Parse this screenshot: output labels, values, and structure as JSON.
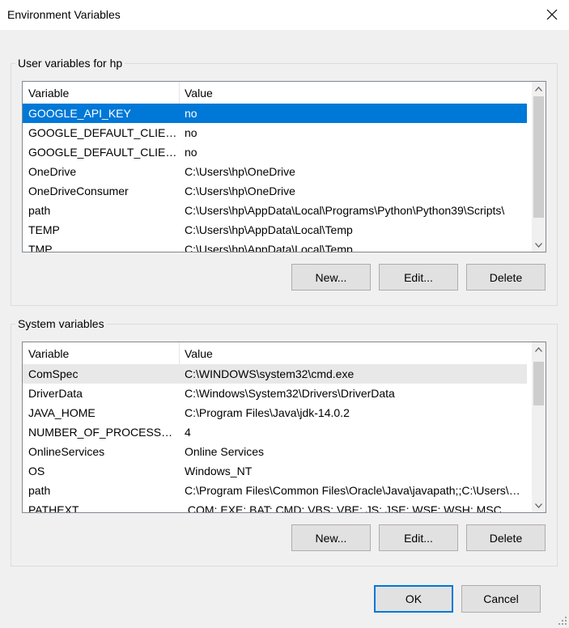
{
  "window": {
    "title": "Environment Variables",
    "close_icon": "close-icon"
  },
  "user_vars": {
    "group_label": "User variables for hp",
    "columns": [
      "Variable",
      "Value"
    ],
    "rows": [
      {
        "name": "GOOGLE_API_KEY",
        "value": "no"
      },
      {
        "name": "GOOGLE_DEFAULT_CLIENT_ID",
        "value": "no"
      },
      {
        "name": "GOOGLE_DEFAULT_CLIENT_SECRET",
        "value": "no"
      },
      {
        "name": "OneDrive",
        "value": "C:\\Users\\hp\\OneDrive"
      },
      {
        "name": "OneDriveConsumer",
        "value": "C:\\Users\\hp\\OneDrive"
      },
      {
        "name": "path",
        "value": "C:\\Users\\hp\\AppData\\Local\\Programs\\Python\\Python39\\Scripts\\"
      },
      {
        "name": "TEMP",
        "value": "C:\\Users\\hp\\AppData\\Local\\Temp"
      },
      {
        "name": "TMP",
        "value": "C:\\Users\\hp\\AppData\\Local\\Temp"
      }
    ],
    "selected_index": 0,
    "buttons": {
      "new": "New...",
      "edit": "Edit...",
      "delete": "Delete"
    }
  },
  "system_vars": {
    "group_label": "System variables",
    "columns": [
      "Variable",
      "Value"
    ],
    "rows": [
      {
        "name": "ComSpec",
        "value": "C:\\WINDOWS\\system32\\cmd.exe"
      },
      {
        "name": "DriverData",
        "value": "C:\\Windows\\System32\\Drivers\\DriverData"
      },
      {
        "name": "JAVA_HOME",
        "value": "C:\\Program Files\\Java\\jdk-14.0.2"
      },
      {
        "name": "NUMBER_OF_PROCESSORS",
        "value": "4"
      },
      {
        "name": "OnlineServices",
        "value": "Online Services"
      },
      {
        "name": "OS",
        "value": "Windows_NT"
      },
      {
        "name": "path",
        "value": "C:\\Program Files\\Common Files\\Oracle\\Java\\javapath;;C:\\Users\\hp\\AppData"
      },
      {
        "name": "PATHEXT",
        "value": ".COM;.EXE;.BAT;.CMD;.VBS;.VBE;.JS;.JSE;.WSF;.WSH;.MSC"
      }
    ],
    "hover_index": 0,
    "buttons": {
      "new": "New...",
      "edit": "Edit...",
      "delete": "Delete"
    }
  },
  "footer": {
    "ok": "OK",
    "cancel": "Cancel"
  },
  "colors": {
    "selection": "#0078d7",
    "default_button_border": "#0078d7"
  }
}
